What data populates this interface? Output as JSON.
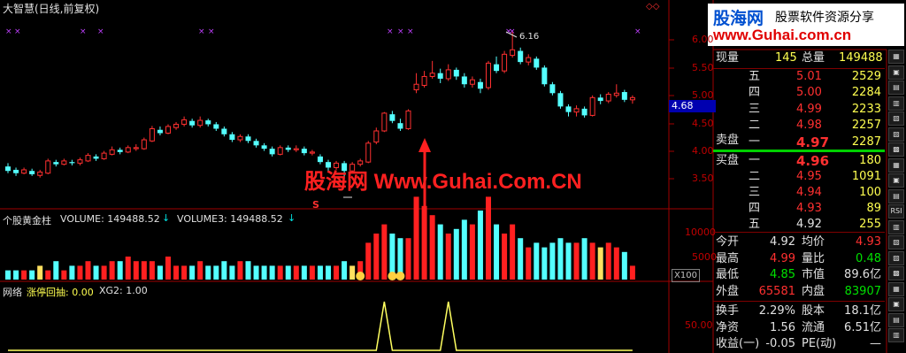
{
  "header": {
    "chart_title": "大智慧(日线,前复权)",
    "logo_text": "股海网",
    "logo_tagline": "股票软件资源分享",
    "logo_url": "www.Guhai.com.cn"
  },
  "watermark": {
    "text": "股海网 Www.Guhai.Com.CN"
  },
  "price_axis": {
    "ticks": [
      "6.00",
      "5.50",
      "5.00",
      "4.50",
      "4.00",
      "3.50"
    ],
    "current_price_tag": "4.68"
  },
  "annotations": {
    "high_label": "6.16",
    "s_marker": "S"
  },
  "volume_panel": {
    "indicator_name": "个股黄金柱",
    "line1": "VOLUME: 149488.52",
    "line2": "VOLUME3: 149488.52",
    "ticks": [
      "10000",
      "5000"
    ],
    "unit": "X100"
  },
  "bottom_panel": {
    "name": "网络",
    "line1": "涨停回抽: 0.00",
    "line2": "XG2: 1.00",
    "tick": "50.00"
  },
  "quote": {
    "xianliang_label": "现量",
    "xianliang": "145",
    "zongliang_label": "总量",
    "zongliang": "149488",
    "sell_label": "卖盘",
    "buy_label": "买盘",
    "asks": [
      {
        "level": "五",
        "price": "5.01",
        "vol": "2529"
      },
      {
        "level": "四",
        "price": "5.00",
        "vol": "2284"
      },
      {
        "level": "三",
        "price": "4.99",
        "vol": "2233"
      },
      {
        "level": "二",
        "price": "4.98",
        "vol": "2257"
      },
      {
        "level": "一",
        "price": "4.97",
        "vol": "2287"
      }
    ],
    "bids": [
      {
        "level": "一",
        "price": "4.96",
        "vol": "180"
      },
      {
        "level": "二",
        "price": "4.95",
        "vol": "1091"
      },
      {
        "level": "三",
        "price": "4.94",
        "vol": "100"
      },
      {
        "level": "四",
        "price": "4.93",
        "vol": "89"
      },
      {
        "level": "五",
        "price": "4.92",
        "vol": "255"
      }
    ],
    "stats": [
      {
        "l1": "今开",
        "v1": "4.92",
        "l2": "均价",
        "v2": "4.93"
      },
      {
        "l1": "最高",
        "v1": "4.99",
        "l2": "量比",
        "v2": "0.48"
      },
      {
        "l1": "最低",
        "v1": "4.85",
        "l2": "市值",
        "v2": "89.6亿"
      },
      {
        "l1": "外盘",
        "v1": "65581",
        "l2": "内盘",
        "v2": "83907"
      }
    ],
    "fin": [
      {
        "l1": "换手",
        "v1": "2.29%",
        "l2": "股本",
        "v2": "18.1亿"
      },
      {
        "l1": "净资",
        "v1": "1.56",
        "l2": "流通",
        "v2": "6.51亿"
      },
      {
        "l1": "收益(一)",
        "v1": "-0.05",
        "l2": "PE(动)",
        "v2": "—"
      }
    ]
  },
  "toolbar": {
    "rsi_label": "RSI"
  },
  "chart_data": {
    "type": "candlestick",
    "ylim": [
      3.3,
      6.3
    ],
    "candles": [
      [
        3.72,
        3.64,
        3.78,
        3.6
      ],
      [
        3.66,
        3.6,
        3.7,
        3.55
      ],
      [
        3.6,
        3.66,
        3.7,
        3.58
      ],
      [
        3.64,
        3.58,
        3.68,
        3.55
      ],
      [
        3.56,
        3.62,
        3.66,
        3.52
      ],
      [
        3.6,
        3.82,
        3.86,
        3.58
      ],
      [
        3.8,
        3.76,
        3.84,
        3.72
      ],
      [
        3.76,
        3.82,
        3.86,
        3.74
      ],
      [
        3.8,
        3.78,
        3.84,
        3.74
      ],
      [
        3.78,
        3.84,
        3.88,
        3.74
      ],
      [
        3.82,
        3.92,
        3.96,
        3.8
      ],
      [
        3.9,
        3.86,
        3.94,
        3.82
      ],
      [
        3.86,
        3.96,
        4.0,
        3.84
      ],
      [
        3.94,
        4.02,
        4.08,
        3.92
      ],
      [
        4.02,
        3.98,
        4.06,
        3.94
      ],
      [
        3.98,
        4.06,
        4.1,
        3.96
      ],
      [
        4.04,
        4.06,
        4.12,
        4.0
      ],
      [
        4.04,
        4.2,
        4.24,
        4.02
      ],
      [
        4.18,
        4.4,
        4.45,
        4.16
      ],
      [
        4.38,
        4.32,
        4.44,
        4.28
      ],
      [
        4.32,
        4.44,
        4.48,
        4.3
      ],
      [
        4.42,
        4.48,
        4.52,
        4.38
      ],
      [
        4.48,
        4.56,
        4.62,
        4.44
      ],
      [
        4.54,
        4.46,
        4.58,
        4.42
      ],
      [
        4.46,
        4.55,
        4.62,
        4.42
      ],
      [
        4.55,
        4.48,
        4.58,
        4.44
      ],
      [
        4.48,
        4.4,
        4.52,
        4.36
      ],
      [
        4.4,
        4.3,
        4.44,
        4.26
      ],
      [
        4.3,
        4.2,
        4.34,
        4.16
      ],
      [
        4.2,
        4.26,
        4.3,
        4.16
      ],
      [
        4.26,
        4.18,
        4.3,
        4.14
      ],
      [
        4.18,
        4.1,
        4.22,
        4.06
      ],
      [
        4.1,
        4.04,
        4.14,
        4.0
      ],
      [
        4.04,
        3.94,
        4.08,
        3.9
      ],
      [
        3.94,
        4.06,
        4.1,
        3.92
      ],
      [
        4.06,
        4.02,
        4.1,
        3.98
      ],
      [
        4.02,
        4.04,
        4.1,
        3.98
      ],
      [
        4.04,
        3.96,
        4.08,
        3.92
      ],
      [
        3.96,
        3.98,
        4.02,
        3.92
      ],
      [
        3.9,
        3.8,
        3.94,
        3.76
      ],
      [
        3.8,
        3.7,
        3.84,
        3.62
      ],
      [
        3.7,
        3.78,
        3.82,
        3.66
      ],
      [
        3.78,
        3.64,
        3.82,
        3.5
      ],
      [
        3.64,
        3.76,
        3.8,
        3.6
      ],
      [
        3.76,
        3.82,
        3.86,
        3.72
      ],
      [
        3.8,
        4.14,
        4.18,
        3.78
      ],
      [
        4.16,
        4.36,
        4.42,
        4.12
      ],
      [
        4.36,
        4.68,
        4.7,
        4.34
      ],
      [
        4.66,
        4.54,
        4.72,
        4.5
      ],
      [
        4.5,
        4.4,
        4.58,
        4.36
      ],
      [
        4.4,
        4.72,
        4.75,
        4.38
      ],
      [
        5.1,
        5.2,
        5.4,
        5.04
      ],
      [
        5.18,
        5.34,
        5.44,
        5.14
      ],
      [
        5.34,
        5.4,
        5.62,
        5.3
      ],
      [
        5.4,
        5.3,
        5.48,
        5.22
      ],
      [
        5.3,
        5.46,
        5.56,
        5.26
      ],
      [
        5.46,
        5.34,
        5.5,
        5.28
      ],
      [
        5.34,
        5.2,
        5.4,
        5.14
      ],
      [
        5.2,
        5.28,
        5.34,
        5.14
      ],
      [
        5.24,
        5.12,
        5.3,
        5.04
      ],
      [
        5.14,
        5.58,
        5.62,
        5.1
      ],
      [
        5.56,
        5.44,
        5.7,
        5.4
      ],
      [
        5.44,
        5.74,
        5.8,
        5.4
      ],
      [
        5.72,
        5.82,
        6.16,
        5.68
      ],
      [
        5.8,
        5.6,
        5.86,
        5.56
      ],
      [
        5.6,
        5.68,
        5.74,
        5.54
      ],
      [
        5.66,
        5.5,
        5.7,
        5.46
      ],
      [
        5.5,
        5.2,
        5.54,
        5.16
      ],
      [
        5.2,
        5.04,
        5.24,
        5.0
      ],
      [
        5.04,
        4.8,
        5.08,
        4.76
      ],
      [
        4.8,
        4.7,
        4.84,
        4.62
      ],
      [
        4.7,
        4.76,
        4.82,
        4.62
      ],
      [
        4.76,
        4.64,
        4.8,
        4.6
      ],
      [
        4.64,
        4.96,
        5.0,
        4.62
      ],
      [
        4.96,
        4.9,
        5.02,
        4.84
      ],
      [
        4.9,
        5.02,
        5.06,
        4.86
      ],
      [
        5.0,
        5.04,
        5.2,
        4.96
      ],
      [
        5.06,
        4.92,
        5.1,
        4.88
      ],
      [
        4.92,
        4.96,
        5.0,
        4.85
      ]
    ],
    "volume": [
      2,
      2,
      2,
      2,
      3,
      2,
      4,
      2,
      3,
      3,
      4,
      3,
      3,
      4,
      4,
      5,
      4,
      4,
      4,
      3,
      5,
      3,
      3,
      3,
      4,
      3,
      3,
      4,
      3,
      4,
      4,
      3,
      3,
      3,
      3,
      3,
      3,
      3,
      3,
      3,
      3,
      3,
      4,
      3,
      4,
      8,
      10,
      12,
      10,
      9,
      9,
      18,
      16,
      14,
      12,
      10,
      11,
      13,
      12,
      15,
      18,
      12,
      10,
      12,
      9,
      7,
      8,
      7,
      8,
      9,
      8,
      8,
      9,
      8,
      7,
      8,
      7,
      6,
      3
    ],
    "vol_markers": [
      4,
      43,
      74
    ],
    "smiley_markers": [
      44,
      48,
      49
    ],
    "bottom_series": [
      0,
      0,
      0,
      0,
      0,
      0,
      0,
      0,
      0,
      0,
      0,
      0,
      0,
      0,
      0,
      0,
      0,
      0,
      0,
      0,
      0,
      0,
      0,
      0,
      0,
      0,
      0,
      0,
      0,
      0,
      0,
      0,
      0,
      0,
      0,
      0,
      0,
      0,
      0,
      0,
      0,
      0,
      0,
      0,
      0,
      0,
      0,
      1,
      0,
      0,
      0,
      0,
      0,
      0,
      0,
      1,
      0,
      0,
      0,
      0,
      0,
      0,
      0,
      0,
      0,
      0,
      0,
      0,
      0,
      0,
      0,
      0,
      0,
      0,
      0,
      0,
      0,
      0,
      0
    ],
    "x_markers": [
      1,
      2,
      11,
      14,
      19,
      21,
      29,
      33,
      38,
      40,
      44,
      54,
      56,
      57,
      59,
      60,
      63,
      69,
      72,
      73,
      77,
      82,
      86,
      89,
      91,
      97
    ]
  }
}
